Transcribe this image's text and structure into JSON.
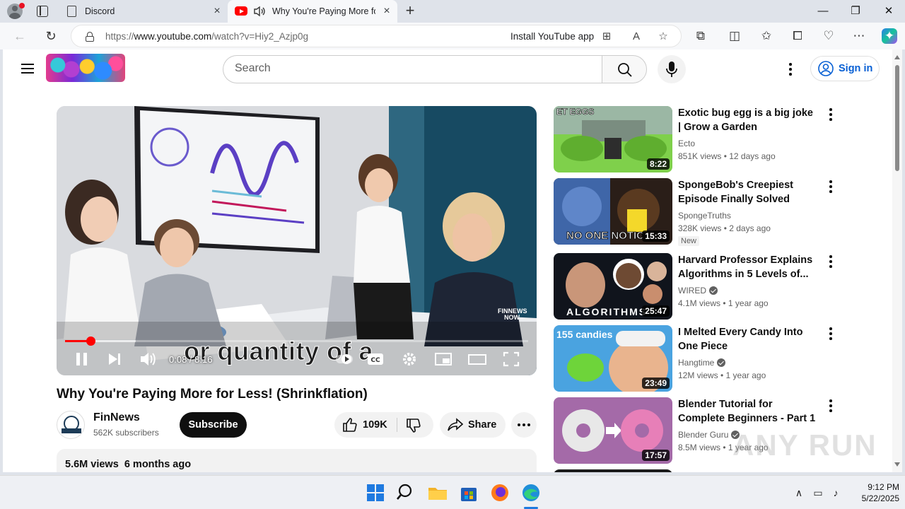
{
  "browser": {
    "tabs": [
      {
        "label": "Discord"
      },
      {
        "label": "Why You're Paying More for Less! (Shrinkflation)"
      }
    ],
    "url_prefix": "https://",
    "url_host": "www.youtube.com",
    "url_path": "/watch?v=Hiy2_Azjp0g",
    "install_app": "Install YouTube app"
  },
  "header": {
    "search_placeholder": "Search",
    "signin_label": "Sign in"
  },
  "player": {
    "caption": "or quantity of a",
    "time": "0:08 / 8:16",
    "progress": 0.016,
    "watermark": "FINNEWS NOW"
  },
  "video": {
    "title": "Why You're Paying More for Less! (Shrinkflation)",
    "channel": "FinNews",
    "subscribers": "562K subscribers",
    "subscribe_label": "Subscribe",
    "likes": "109K",
    "share_label": "Share",
    "views": "5.6M views",
    "uploaded": "6 months ago"
  },
  "recommendations": [
    {
      "title": "Exotic bug egg is a big joke | Grow a Garden",
      "channel": "Ecto",
      "verified": false,
      "meta": "851K views • 12 days ago",
      "duration": "8:22",
      "badge": ""
    },
    {
      "title": "SpongeBob's Creepiest Episode Finally Solved",
      "channel": "SpongeTruths",
      "verified": false,
      "meta": "328K views • 2 days ago",
      "duration": "15:33",
      "badge": "New"
    },
    {
      "title": "Harvard Professor Explains Algorithms in 5 Levels of...",
      "channel": "WIRED",
      "verified": true,
      "meta": "4.1M views • 1 year ago",
      "duration": "25:47",
      "badge": ""
    },
    {
      "title": "I Melted Every Candy Into One Piece",
      "channel": "Hangtime",
      "verified": true,
      "meta": "12M views • 1 year ago",
      "duration": "23:49",
      "badge": ""
    },
    {
      "title": "Blender Tutorial for Complete Beginners - Part 1",
      "channel": "Blender Guru",
      "verified": true,
      "meta": "8.5M views • 1 year ago",
      "duration": "17:57",
      "badge": ""
    }
  ],
  "thumb_text": {
    "rec0": "ET EGGS",
    "rec1": "NO ONE NOTIC",
    "rec2": "ALGORITHMS",
    "rec3": "155 candies"
  },
  "taskbar": {
    "time": "9:12 PM",
    "date": "5/22/2025"
  },
  "watermark_overlay": "ANY RUN"
}
